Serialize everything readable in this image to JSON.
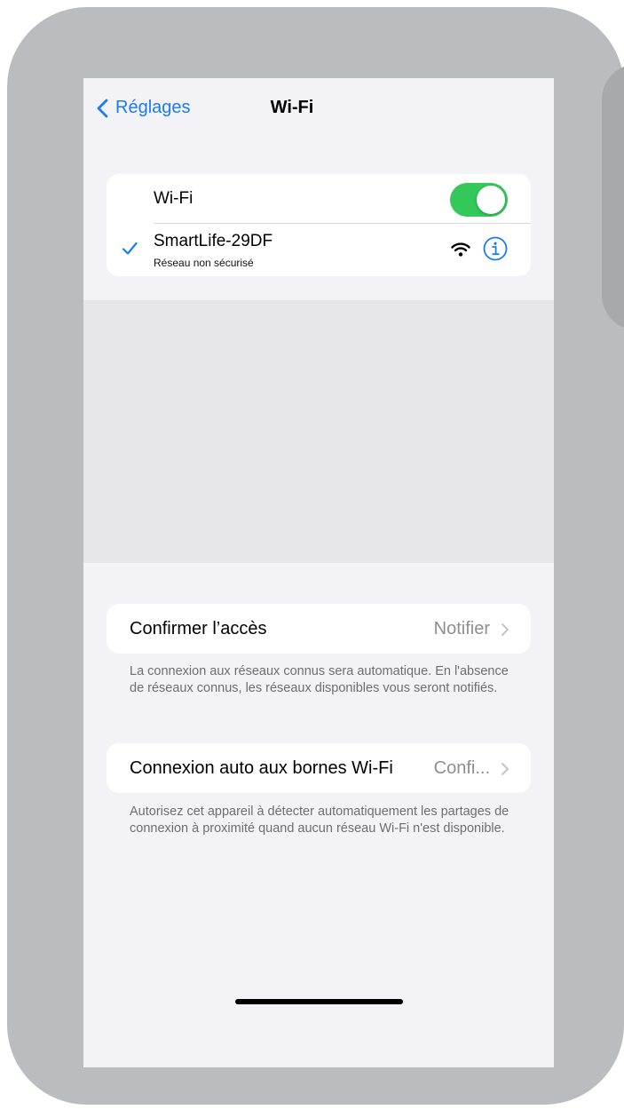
{
  "navbar": {
    "back_label": "Réglages",
    "title": "Wi-Fi"
  },
  "wifi_section": {
    "toggle_label": "Wi-Fi",
    "toggle_on": true,
    "network": {
      "name": "SmartLife-29DF",
      "status": "Réseau non sécurisé",
      "connected": true
    }
  },
  "ask_to_join": {
    "label": "Confirmer l’accès",
    "value": "Notifier",
    "footer": "La connexion aux réseaux connus sera automatique. En l'absence de réseaux connus, les réseaux disponibles vous seront notifiés."
  },
  "auto_join_hotspot": {
    "label": "Connexion auto aux bornes Wi-Fi",
    "value": "Confi...",
    "footer": "Autorisez cet appareil à détecter automatiquement les partages de connexion à proximité quand aucun réseau Wi-Fi n'est disponible."
  },
  "colors": {
    "accent": "#1a7cf5",
    "toggle_on": "#34c759",
    "background": "#f2f2f7"
  }
}
